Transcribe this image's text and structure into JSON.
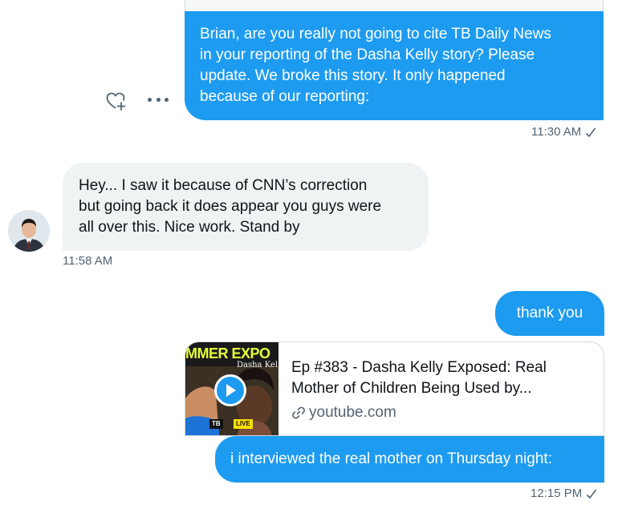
{
  "conversation": {
    "messages": [
      {
        "direction": "outgoing",
        "text": "Brian, are you really not going to cite TB Daily News in your reporting of the Dasha Kelly story? Please update. We broke this story. It only happened because of our reporting:",
        "lines": [
          "Brian, are you really not going to cite TB Daily News",
          "in your reporting of the Dasha Kelly story? Please",
          "update. We broke this story. It only happened",
          "because of our reporting:"
        ],
        "timestamp": "11:30 AM"
      },
      {
        "direction": "incoming",
        "lines": [
          "Hey... I saw it because of CNN’s correction",
          "but going back it does appear you guys were",
          "all over this. Nice work. Stand by"
        ],
        "timestamp": "11:58 AM"
      },
      {
        "direction": "outgoing",
        "text": "thank you"
      },
      {
        "direction": "outgoing",
        "link_card": {
          "title_lines": [
            "Ep #383 - Dasha Kelly Exposed: Real",
            "Mother of Children Being Used by..."
          ],
          "domain": "youtube.com",
          "thumbnail": {
            "banner_text": "MMER EXPO",
            "name_text": "Dasha Kel",
            "badge_text": "TB",
            "live_text": "LIVE"
          }
        },
        "text": "i interviewed the real mother on Thursday night:",
        "timestamp": "12:15 PM"
      }
    ]
  },
  "icons": {
    "react": "heart-plus-icon",
    "more": "more-options-icon",
    "read": "checkmark-icon",
    "link": "link-icon",
    "play": "play-icon"
  },
  "colors": {
    "accent": "#1d9bf0",
    "incoming_bubble": "#eff3f4",
    "secondary_text": "#536471"
  }
}
